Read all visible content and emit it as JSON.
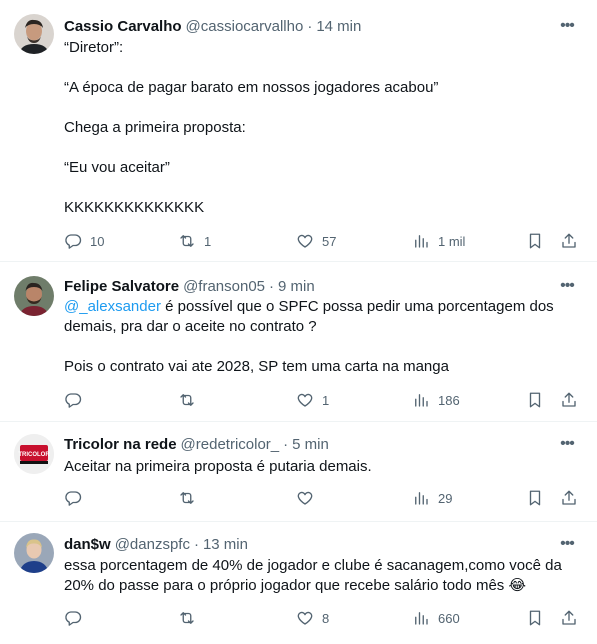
{
  "tweets": [
    {
      "name": "Cassio Carvalho",
      "handle": "@cassiocarvallho",
      "dot": "·",
      "time": "14 min",
      "lines": [
        "“Diretor”:",
        "“A época de pagar barato em nossos jogadores acabou”",
        "Chega a primeira proposta:",
        "“Eu vou aceitar”",
        "KKKKKKKKKKKKKK"
      ],
      "replies": "10",
      "retweets": "1",
      "likes": "57",
      "views": "1 mil"
    },
    {
      "name": "Felipe Salvatore",
      "handle": "@franson05",
      "dot": "·",
      "time": "9 min",
      "mention": "@_alexsander",
      "lines": [
        " é possível que o SPFC possa pedir uma porcentagem dos demais, pra dar o aceite no contrato ?",
        "Pois o contrato vai ate 2028, SP tem uma carta na manga"
      ],
      "replies": "",
      "retweets": "",
      "likes": "1",
      "views": "186"
    },
    {
      "name": "Tricolor na rede",
      "handle": "@redetricolor_",
      "dot": "·",
      "time": "5 min",
      "avatar_text": "TRICOLOR",
      "lines": [
        "Aceitar na primeira proposta é putaria demais."
      ],
      "replies": "",
      "retweets": "",
      "likes": "",
      "views": "29"
    },
    {
      "name": "dan$w",
      "handle": "@danzspfc",
      "dot": "·",
      "time": "13 min",
      "lines": [
        "essa porcentagem de 40% de jogador e clube é sacanagem,como você da 20% do passe para o próprio jogador que recebe salário todo mês 😂"
      ],
      "replies": "",
      "retweets": "",
      "likes": "8",
      "views": "660"
    }
  ],
  "icons": {
    "more": "more-horizontal-icon",
    "reply": "reply-icon",
    "retweet": "retweet-icon",
    "like": "heart-icon",
    "views": "views-icon",
    "bookmark": "bookmark-icon",
    "share": "share-icon"
  },
  "colors": {
    "text": "#0f1419",
    "muted": "#536471",
    "link": "#1d9bf0",
    "border": "#eff3f4"
  }
}
